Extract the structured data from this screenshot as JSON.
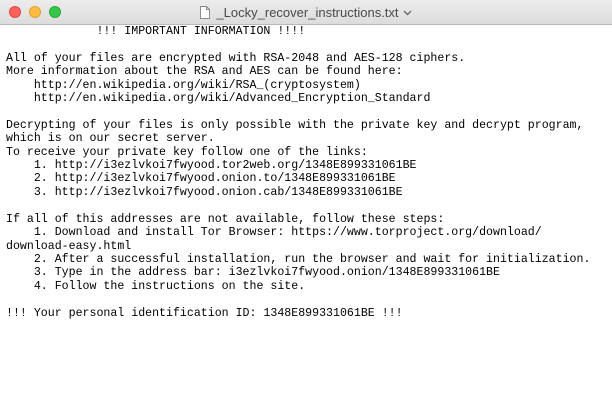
{
  "window": {
    "title": "_Locky_recover_instructions.txt"
  },
  "document": {
    "lines": [
      "             !!! IMPORTANT INFORMATION !!!!",
      "",
      "All of your files are encrypted with RSA-2048 and AES-128 ciphers.",
      "More information about the RSA and AES can be found here:",
      "    http://en.wikipedia.org/wiki/RSA_(cryptosystem)",
      "    http://en.wikipedia.org/wiki/Advanced_Encryption_Standard",
      "",
      "Decrypting of your files is only possible with the private key and decrypt program,",
      "which is on our secret server.",
      "To receive your private key follow one of the links:",
      "    1. http://i3ezlvkoi7fwyood.tor2web.org/1348E899331061BE",
      "    2. http://i3ezlvkoi7fwyood.onion.to/1348E899331061BE",
      "    3. http://i3ezlvkoi7fwyood.onion.cab/1348E899331061BE",
      "",
      "If all of this addresses are not available, follow these steps:",
      "    1. Download and install Tor Browser: https://www.torproject.org/download/",
      "download-easy.html",
      "    2. After a successful installation, run the browser and wait for initialization.",
      "    3. Type in the address bar: i3ezlvkoi7fwyood.onion/1348E899331061BE",
      "    4. Follow the instructions on the site.",
      "",
      "!!! Your personal identification ID: 1348E899331061BE !!!"
    ]
  },
  "icons": {
    "close": "close-button",
    "minimize": "minimize-button",
    "zoom": "zoom-button",
    "document": "document-icon",
    "title_menu": "chevron-down-icon"
  },
  "colors": {
    "close": "#fc605c",
    "minimize": "#fdbc40",
    "zoom": "#34c84a",
    "text": "#000000",
    "background": "#ffffff"
  }
}
